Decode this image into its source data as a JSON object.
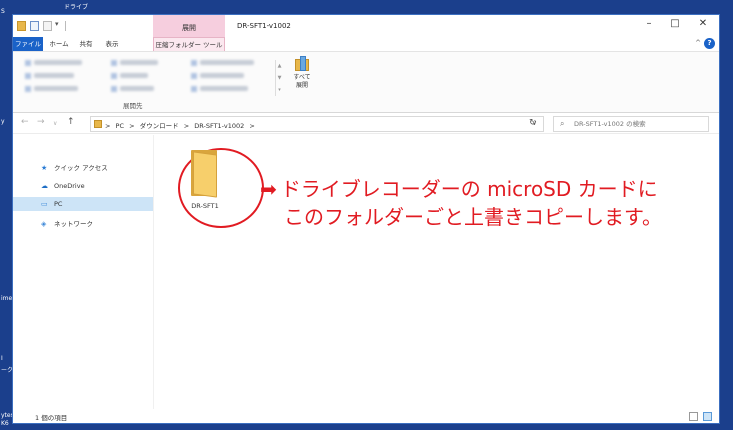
{
  "desktop": {
    "top_label": "ドライブ",
    "left_fragments": [
      "S",
      "y",
      "ime",
      "I",
      "ーク",
      "ytes",
      "K6"
    ]
  },
  "window": {
    "title": "DR-SFT1-v1002",
    "context_tab_group": "展開",
    "controls": {
      "minimize": "–",
      "maximize": "□",
      "close": "✕"
    }
  },
  "ribbon": {
    "tabs": [
      {
        "label": "ファイル"
      },
      {
        "label": "ホーム"
      },
      {
        "label": "共有"
      },
      {
        "label": "表示"
      },
      {
        "label": "圧縮フォルダー ツール"
      }
    ],
    "collapse_glyph": "^",
    "help_glyph": "?",
    "group_label": "展開先",
    "extract_all_label_1": "すべて",
    "extract_all_label_2": "展開"
  },
  "address_bar": {
    "back": "←",
    "forward": "→",
    "recent": "∨",
    "up": "↑",
    "breadcrumbs": [
      "PC",
      "ダウンロード",
      "DR-SFT1-v1002"
    ],
    "separator": ">",
    "dropdown": "∨",
    "refresh": "↻",
    "search_placeholder": "DR-SFT1-v1002 の検索",
    "search_glyph": "⌕"
  },
  "nav_pane": {
    "items": [
      {
        "label": "クイック アクセス",
        "icon": "star-icon",
        "glyph": "★"
      },
      {
        "label": "OneDrive",
        "icon": "cloud-icon",
        "glyph": "☁"
      },
      {
        "label": "PC",
        "icon": "pc-icon",
        "glyph": "▭",
        "selected": true
      },
      {
        "label": "ネットワーク",
        "icon": "network-icon",
        "glyph": "◈"
      }
    ]
  },
  "content": {
    "folder_name": "DR-SFT1",
    "instruction_arrow": "➡",
    "instruction_line1": "ドライブレコーダーの microSD カードに",
    "instruction_line2": "このフォルダーごと上書きコピーします。"
  },
  "status_bar": {
    "item_count": "1 個の項目"
  },
  "colors": {
    "accent_blue": "#1a62c8",
    "annotation_red": "#e11b22",
    "context_tab_pink": "#f6cede",
    "selection": "#cde4f7"
  }
}
